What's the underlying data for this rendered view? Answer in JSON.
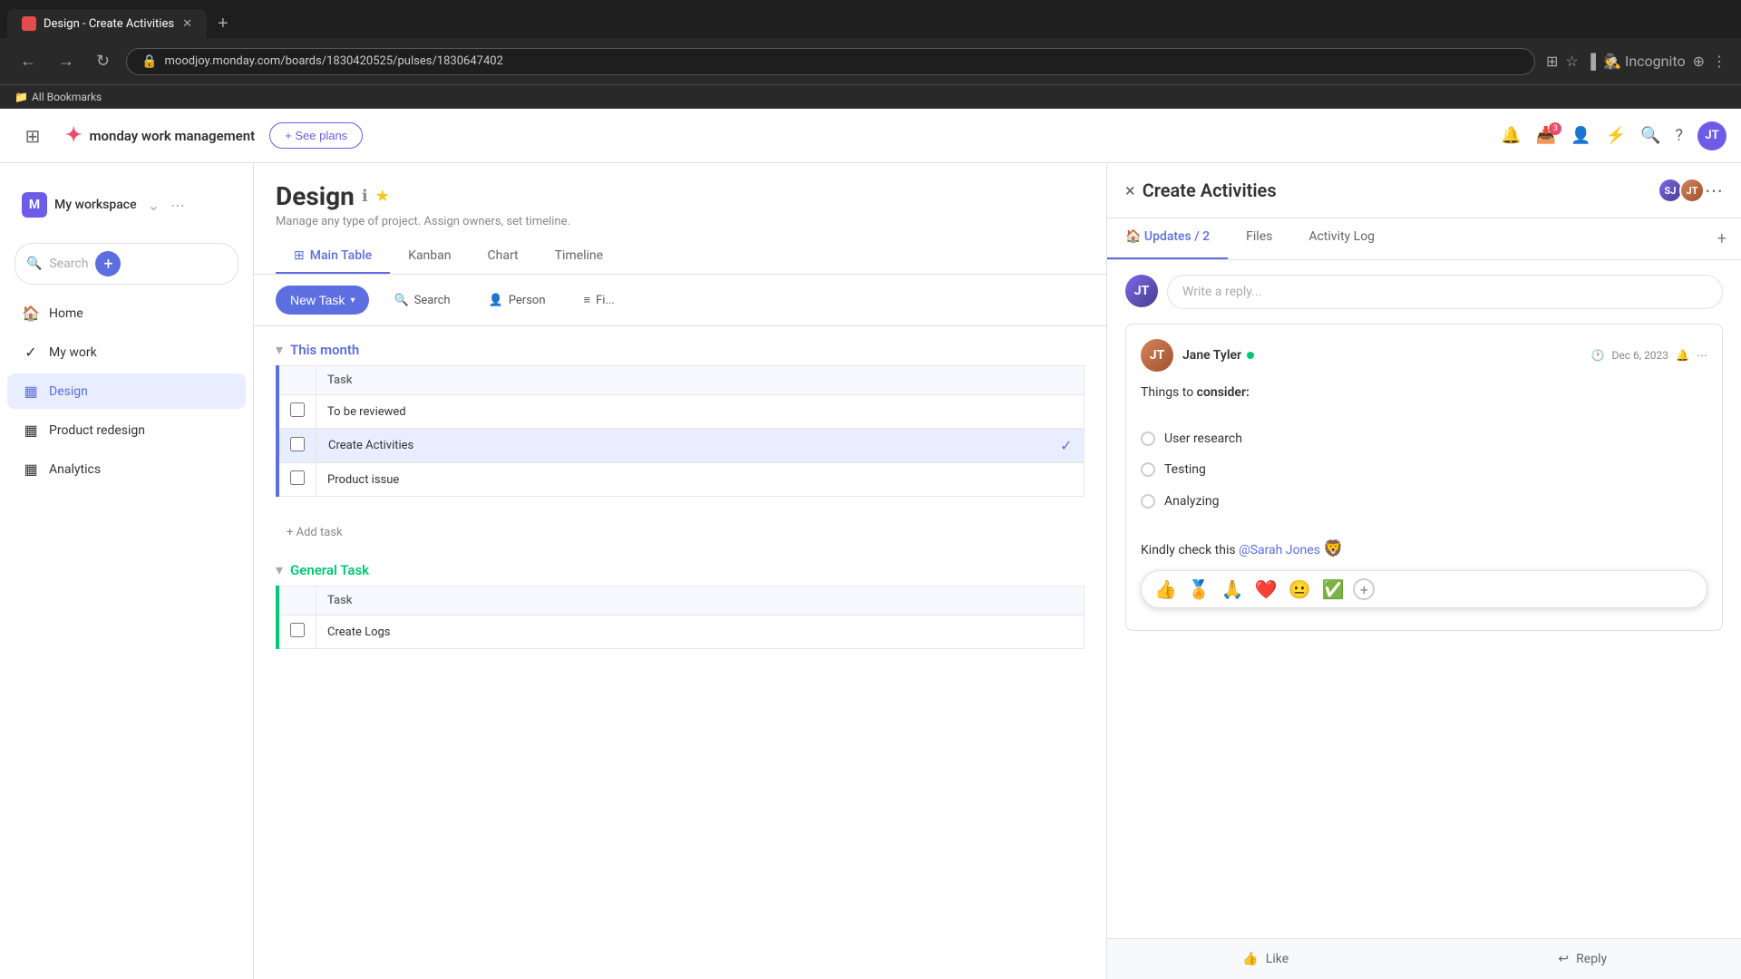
{
  "browser": {
    "tab_title": "Design - Create Activities",
    "tab_favicon": "🟥",
    "url": "moodjoy.monday.com/boards/1830420525/pulses/1830647402",
    "new_tab_label": "+",
    "nav_back": "←",
    "nav_forward": "→",
    "nav_refresh": "↻",
    "incognito_label": "Incognito",
    "bookmarks_label": "All Bookmarks"
  },
  "app": {
    "logo_text": "monday work management",
    "see_plans_label": "+ See plans",
    "notification_count": "3"
  },
  "sidebar": {
    "search_placeholder": "Search",
    "add_btn_label": "+",
    "workspace_name": "My workspace",
    "workspace_icon": "M",
    "items": [
      {
        "label": "Home",
        "icon": "🏠"
      },
      {
        "label": "My work",
        "icon": "✓"
      },
      {
        "label": "Design",
        "icon": "▦",
        "active": true
      },
      {
        "label": "Product redesign",
        "icon": "▦"
      },
      {
        "label": "Analytics",
        "icon": "▦"
      }
    ]
  },
  "board": {
    "title": "Design",
    "description": "Manage any type of project. Assign owners, set timeline.",
    "tabs": [
      {
        "label": "Main Table",
        "active": true
      },
      {
        "label": "Kanban"
      },
      {
        "label": "Chart"
      },
      {
        "label": "Timeline"
      }
    ],
    "toolbar": {
      "new_task": "New Task",
      "search": "Search",
      "person": "Person",
      "filter": "Fi..."
    },
    "groups": [
      {
        "name": "This month",
        "color": "#5c6ee0",
        "tasks": [
          {
            "name": "To be reviewed",
            "selected": false
          },
          {
            "name": "Create Activities",
            "selected": true,
            "done": true
          },
          {
            "name": "Product issue",
            "selected": false
          }
        ]
      },
      {
        "name": "General Task",
        "color": "#00c875",
        "tasks": [
          {
            "name": "Create Logs",
            "selected": false
          }
        ]
      }
    ],
    "add_task_label": "+ Add task",
    "column_header": "Task"
  },
  "panel": {
    "title": "Create Activities",
    "close_label": "×",
    "more_label": "⋯",
    "tabs": [
      {
        "label": "Updates / 2",
        "active": true
      },
      {
        "label": "Files"
      },
      {
        "label": "Activity Log"
      }
    ],
    "add_btn": "+",
    "reply_placeholder": "Write a reply...",
    "comment": {
      "author": "Jane Tyler",
      "online": true,
      "date": "Dec 6, 2023",
      "body_intro": "Things to ",
      "body_bold": "consider:",
      "checklist": [
        {
          "label": "User research"
        },
        {
          "label": "Testing"
        },
        {
          "label": "Analyzing"
        }
      ],
      "mention_text": "Kindly check this @Sarah Jones 🦁"
    },
    "emoji_bar": [
      "👍",
      "🏅",
      "🙏",
      "❤️",
      "😐",
      "✅",
      "+"
    ],
    "like_label": "Like",
    "reply_label": "Reply"
  }
}
